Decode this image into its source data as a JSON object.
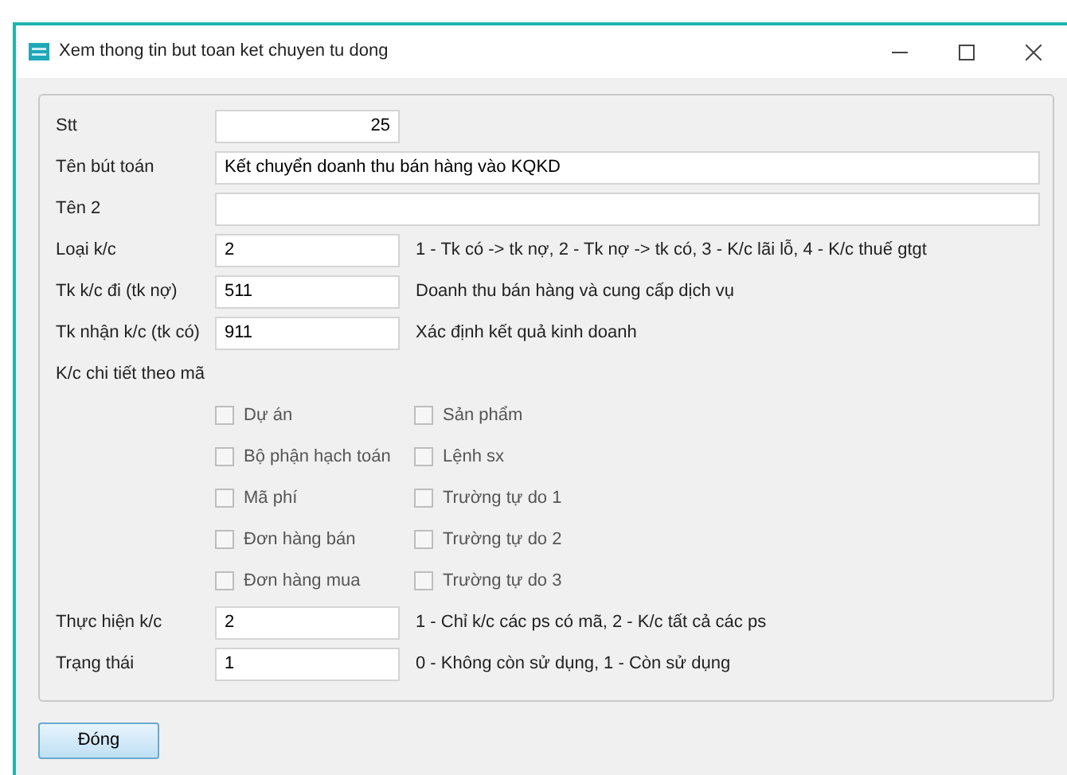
{
  "window": {
    "title": "Xem thong tin but toan ket chuyen tu dong"
  },
  "fields_top": [
    {
      "label": "Stt",
      "kind": "number",
      "value": "25"
    },
    {
      "label": "Tên bút toán",
      "kind": "wide",
      "value": "Kết chuyển doanh thu bán hàng vào KQKD"
    },
    {
      "label": "Tên 2",
      "kind": "wide"
    },
    {
      "label": "Loại k/c",
      "kind": "short",
      "value": "2",
      "hint": "1 - Tk có -> tk nợ, 2 - Tk nợ -> tk có, 3 - K/c lãi lỗ, 4 - K/c thuế gtgt"
    },
    {
      "label": "Tk k/c đi (tk nợ)",
      "kind": "short",
      "value": "511",
      "hint": "Doanh thu bán hàng và cung cấp dịch vụ"
    },
    {
      "label": "Tk nhận k/c (tk có)",
      "kind": "short",
      "value": "911",
      "hint": "Xác định kết quả kinh doanh"
    }
  ],
  "detail_label": "K/c chi tiết theo mã",
  "checkbox_rows": [
    [
      {
        "label": "Dự án",
        "checked": false
      },
      {
        "label": "Sản phẩm",
        "checked": false
      }
    ],
    [
      {
        "label": "Bộ phận hạch toán",
        "checked": false
      },
      {
        "label": "Lệnh sx",
        "checked": false
      }
    ],
    [
      {
        "label": "Mã phí",
        "checked": false
      },
      {
        "label": "Trường tự do 1",
        "checked": false
      }
    ],
    [
      {
        "label": "Đơn hàng bán",
        "checked": false
      },
      {
        "label": "Trường tự do 2",
        "checked": false
      }
    ],
    [
      {
        "label": "Đơn hàng mua",
        "checked": false
      },
      {
        "label": "Trường tự do 3",
        "checked": false
      }
    ]
  ],
  "fields_bottom": [
    {
      "label": "Thực hiện k/c",
      "kind": "short",
      "value": "2",
      "hint": "1 - Chỉ k/c các ps có mã, 2 - K/c tất cả các ps"
    },
    {
      "label": "Trạng thái",
      "kind": "short",
      "value": "1",
      "hint": "0 - Không còn sử dụng, 1 - Còn sử dụng"
    }
  ],
  "buttons": [
    "Đóng"
  ]
}
